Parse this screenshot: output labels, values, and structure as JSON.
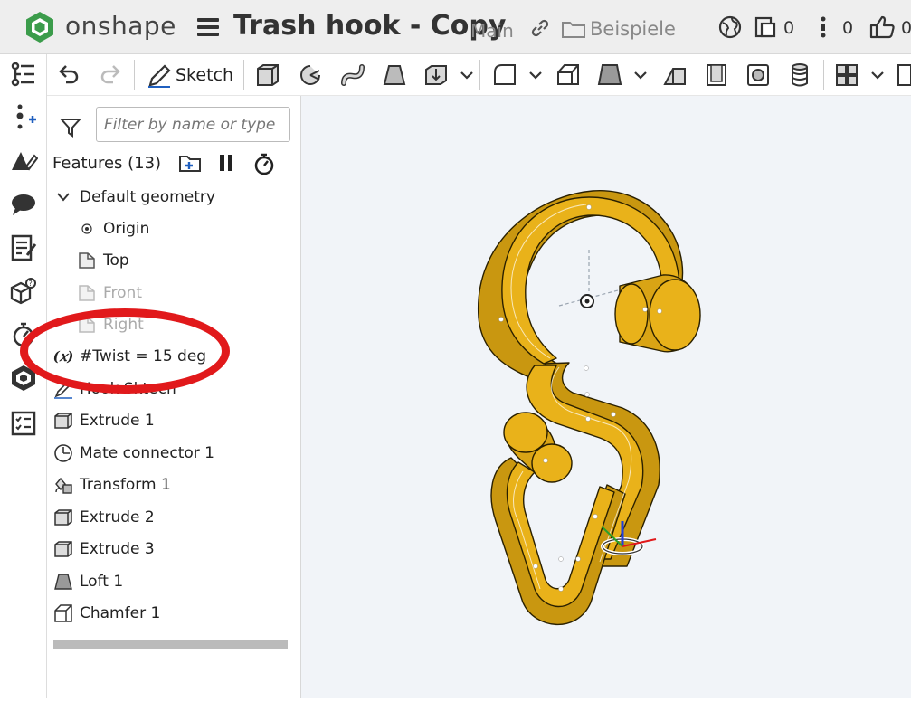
{
  "app": {
    "brand": "onshape"
  },
  "document": {
    "title": "Trash hook - Copy",
    "branch": "Main",
    "folder": "Beispiele"
  },
  "top_counters": {
    "versions": "0",
    "info": "0",
    "likes": "0"
  },
  "toolbar": {
    "sketch_label": "Sketch"
  },
  "feature_panel": {
    "filter_placeholder": "Filter by name or type",
    "header": "Features (13)",
    "default_geometry": {
      "label": "Default geometry",
      "items": [
        {
          "label": "Origin",
          "icon": "origin-icon",
          "dimmed": false
        },
        {
          "label": "Top",
          "icon": "plane-icon",
          "dimmed": false
        },
        {
          "label": "Front",
          "icon": "plane-icon",
          "dimmed": true
        },
        {
          "label": "Right",
          "icon": "plane-icon",
          "dimmed": true
        }
      ]
    },
    "features": [
      {
        "label": "#Twist = 15 deg",
        "icon": "variable-icon"
      },
      {
        "label": "Hook Sktech",
        "icon": "sketch-icon"
      },
      {
        "label": "Extrude 1",
        "icon": "extrude-icon"
      },
      {
        "label": "Mate connector 1",
        "icon": "mate-connector-icon"
      },
      {
        "label": "Transform 1",
        "icon": "transform-icon"
      },
      {
        "label": "Extrude 2",
        "icon": "extrude-icon"
      },
      {
        "label": "Extrude 3",
        "icon": "extrude-icon"
      },
      {
        "label": "Loft 1",
        "icon": "loft-icon"
      },
      {
        "label": "Chamfer 1",
        "icon": "chamfer-icon"
      }
    ]
  },
  "colors": {
    "part": "#e9b21a",
    "annotation": "#e1191b",
    "viewport": "#f1f4f8",
    "accent_blue": "#1f5fbf"
  }
}
